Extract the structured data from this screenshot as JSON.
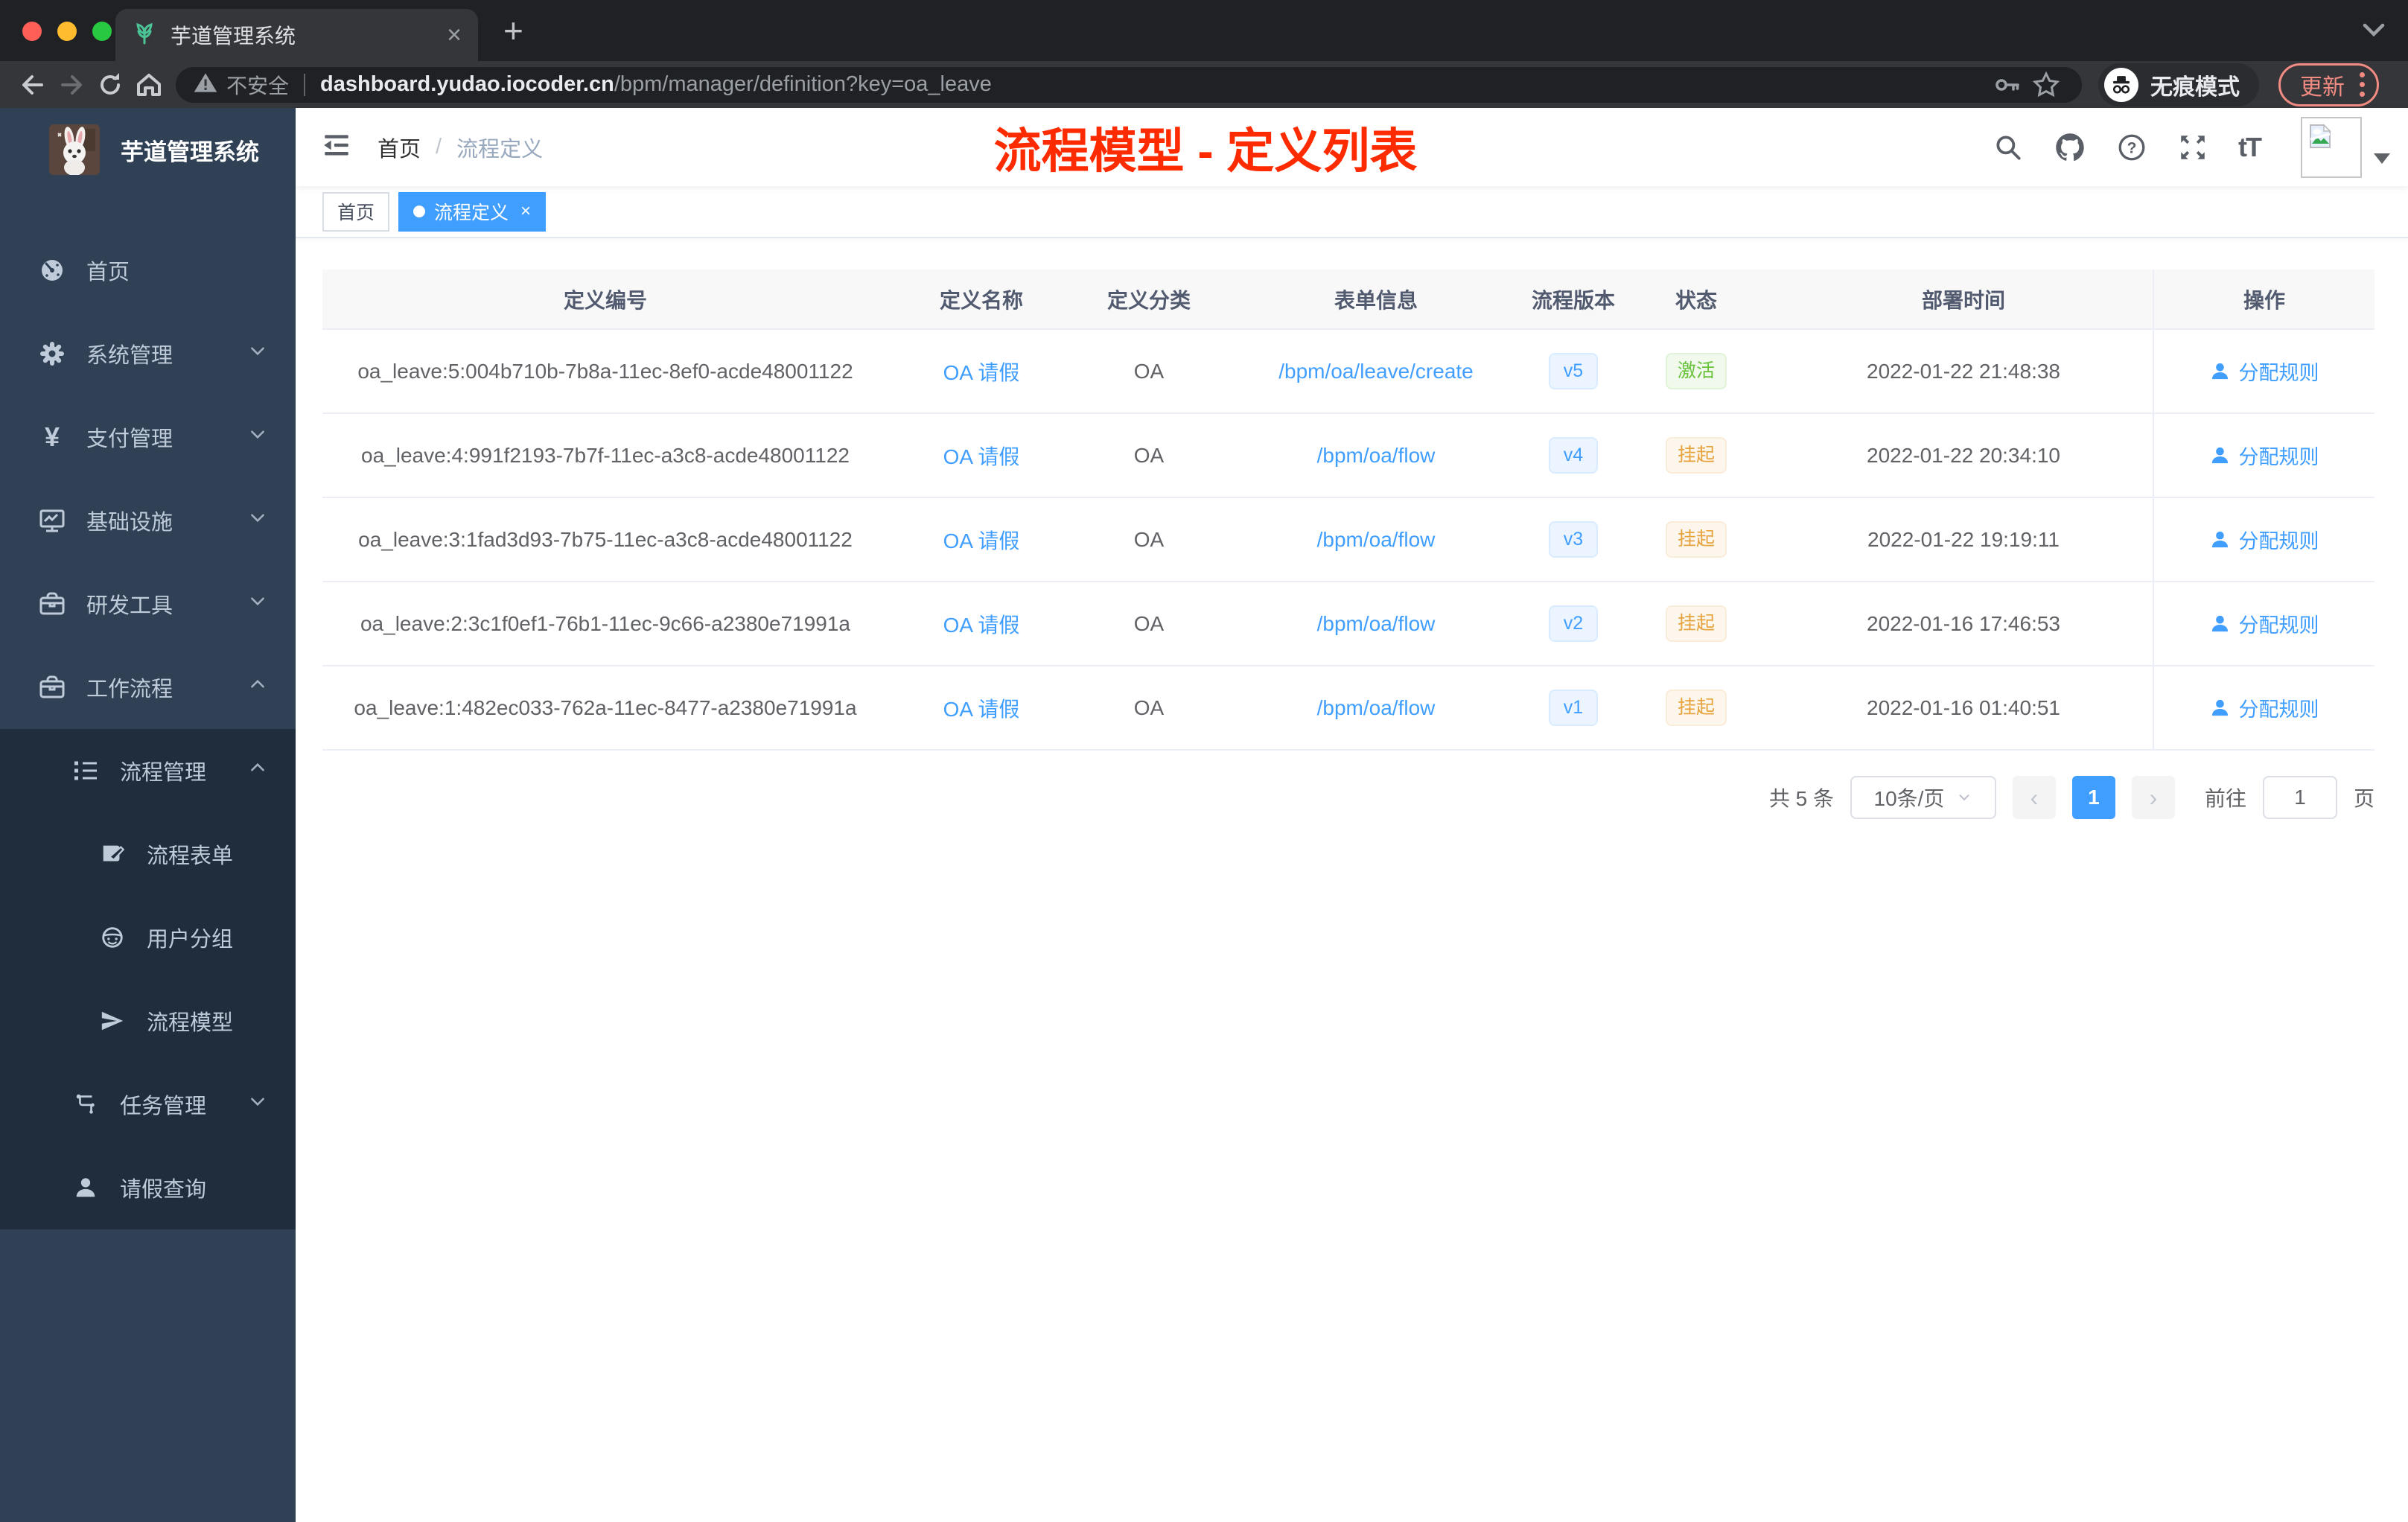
{
  "colors": {
    "accent_blue": "#409eff",
    "status_active_green": "#67c23a",
    "status_suspend_orange": "#e6a23c",
    "annotation_red": "#fe2b00",
    "sidebar_bg": "#304156",
    "submenu_bg": "#1f2d3d",
    "chrome_dark": "#202124",
    "toolbar_dark": "#35363a",
    "update_salmon": "#f28b82"
  },
  "browser": {
    "tab_title": "芋道管理系统",
    "close_tab": "×",
    "new_tab": "+",
    "security_label": "不安全",
    "url_host": "dashboard.yudao.iocoder.cn",
    "url_path": "/bpm/manager/definition?key=oa_leave",
    "incognito_label": "无痕模式",
    "update_label": "更新"
  },
  "sidebar": {
    "logo_title": "芋道管理系统",
    "items": [
      {
        "label": "首页"
      },
      {
        "label": "系统管理"
      },
      {
        "label": "支付管理"
      },
      {
        "label": "基础设施"
      },
      {
        "label": "研发工具"
      },
      {
        "label": "工作流程"
      },
      {
        "label": "流程管理"
      },
      {
        "label": "流程表单"
      },
      {
        "label": "用户分组"
      },
      {
        "label": "流程模型"
      },
      {
        "label": "任务管理"
      },
      {
        "label": "请假查询"
      }
    ]
  },
  "navbar": {
    "breadcrumb_home": "首页",
    "breadcrumb_sep": "/",
    "breadcrumb_current": "流程定义",
    "annotation": "流程模型 - 定义列表"
  },
  "tags": [
    {
      "label": "首页"
    },
    {
      "label": "流程定义",
      "close": "×"
    }
  ],
  "table": {
    "columns": [
      "定义编号",
      "定义名称",
      "定义分类",
      "表单信息",
      "流程版本",
      "状态",
      "部署时间",
      "操作"
    ],
    "rows": [
      {
        "id": "oa_leave:5:004b710b-7b8a-11ec-8ef0-acde48001122",
        "name": "OA 请假",
        "category": "OA",
        "form": "/bpm/oa/leave/create",
        "version": "v5",
        "status": "激活",
        "deploy_time": "2022-01-22 21:48:38",
        "action": "分配规则"
      },
      {
        "id": "oa_leave:4:991f2193-7b7f-11ec-a3c8-acde48001122",
        "name": "OA 请假",
        "category": "OA",
        "form": "/bpm/oa/flow",
        "version": "v4",
        "status": "挂起",
        "deploy_time": "2022-01-22 20:34:10",
        "action": "分配规则"
      },
      {
        "id": "oa_leave:3:1fad3d93-7b75-11ec-a3c8-acde48001122",
        "name": "OA 请假",
        "category": "OA",
        "form": "/bpm/oa/flow",
        "version": "v3",
        "status": "挂起",
        "deploy_time": "2022-01-22 19:19:11",
        "action": "分配规则"
      },
      {
        "id": "oa_leave:2:3c1f0ef1-76b1-11ec-9c66-a2380e71991a",
        "name": "OA 请假",
        "category": "OA",
        "form": "/bpm/oa/flow",
        "version": "v2",
        "status": "挂起",
        "deploy_time": "2022-01-16 17:46:53",
        "action": "分配规则"
      },
      {
        "id": "oa_leave:1:482ec033-762a-11ec-8477-a2380e71991a",
        "name": "OA 请假",
        "category": "OA",
        "form": "/bpm/oa/flow",
        "version": "v1",
        "status": "挂起",
        "deploy_time": "2022-01-16 01:40:51",
        "action": "分配规则"
      }
    ]
  },
  "pagination": {
    "total": "共 5 条",
    "page_size": "10条/页",
    "prev": "‹",
    "current_page": "1",
    "next": "›",
    "goto_label": "前往",
    "goto_value": "1",
    "page_unit": "页"
  }
}
